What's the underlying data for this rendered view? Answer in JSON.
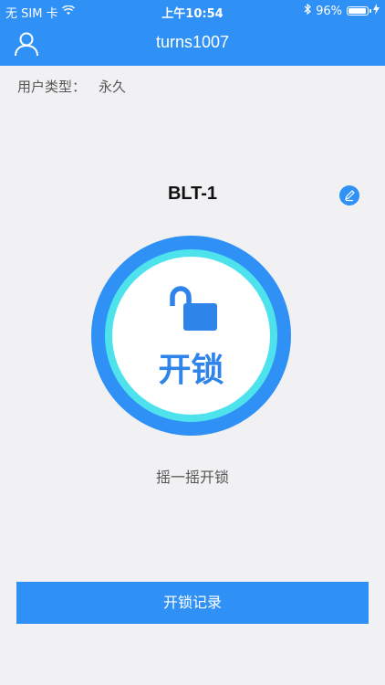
{
  "status_bar": {
    "carrier": "无 SIM 卡",
    "time": "上午10:54",
    "battery_percent": "96%",
    "battery_level": 0.96,
    "icons": [
      "wifi-icon",
      "bluetooth-icon",
      "battery-icon",
      "charging-icon"
    ]
  },
  "nav": {
    "title": "turns1007",
    "profile_icon": "user-icon"
  },
  "user_type": {
    "label": "用户类型：",
    "value": "永久"
  },
  "device": {
    "name": "BLT-1",
    "edit_icon": "edit-pencil-icon"
  },
  "unlock": {
    "label": "开锁",
    "icon": "unlocked-padlock-icon",
    "hint": "摇一摇开锁"
  },
  "record_button": {
    "label": "开锁记录"
  },
  "colors": {
    "primary": "#2f91f5",
    "ring": "#4ee3ec",
    "background": "#f1f1f3"
  }
}
